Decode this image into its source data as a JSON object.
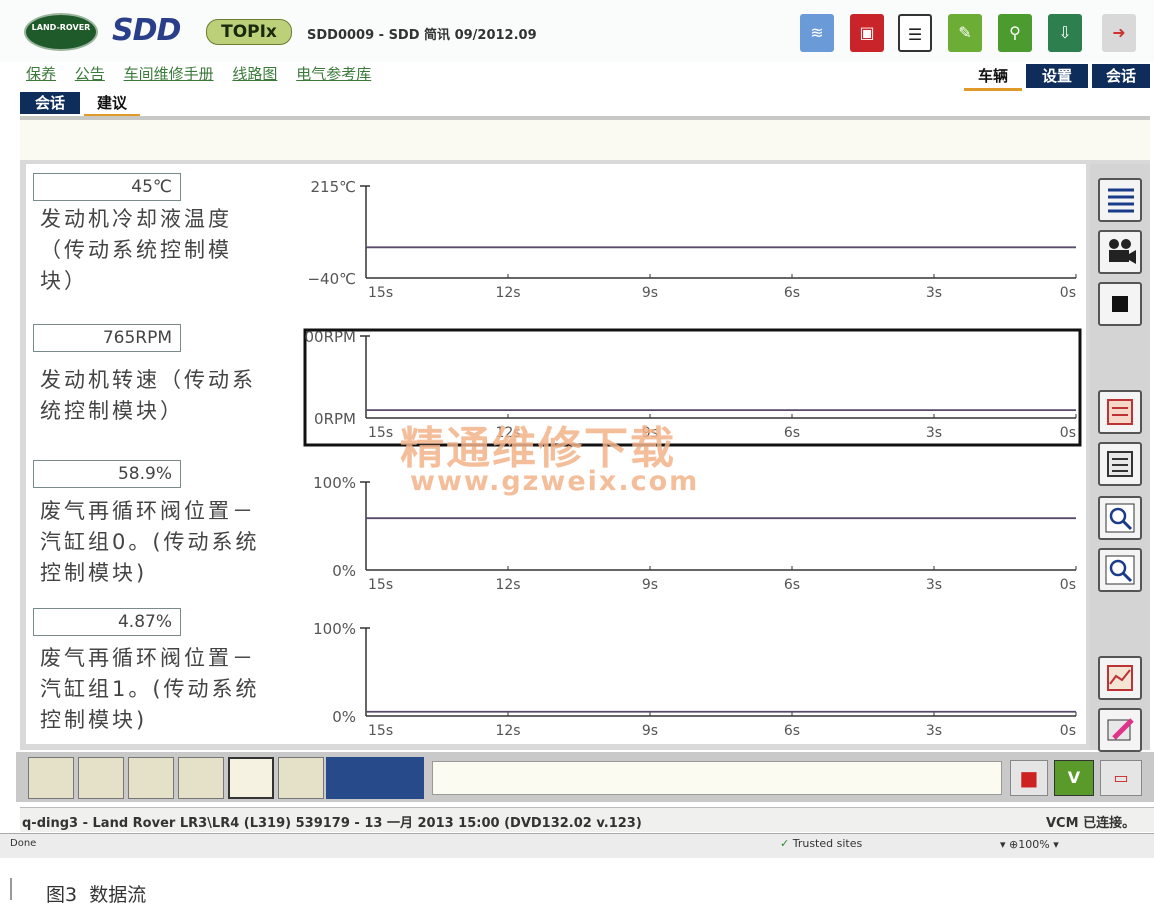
{
  "header": {
    "logo_text": "LAND-ROVER",
    "app_name": "SDD",
    "product": "TOPIx",
    "session_title": "SDD0009 - SDD 简讯 09/2012.09"
  },
  "links": [
    "保养",
    "公告",
    "车间维修手册",
    "线路图",
    "电气参考库"
  ],
  "nav_tabs": [
    {
      "label": "车辆",
      "active": true
    },
    {
      "label": "设置",
      "active": false
    },
    {
      "label": "会话",
      "active": false
    }
  ],
  "sub_tabs": [
    {
      "label": "会话",
      "active": false
    },
    {
      "label": "建议",
      "active": true
    }
  ],
  "signals": [
    {
      "value": "45℃",
      "label": "发动机冷却液温度（传动系统控制模块）"
    },
    {
      "value": "765RPM",
      "label": "发动机转速（传动系统控制模块）"
    },
    {
      "value": "58.9%",
      "label": "废气再循环阀位置－汽缸组0。(传动系统控制模块)"
    },
    {
      "value": "4.87%",
      "label": "废气再循环阀位置－汽缸组1。(传动系统控制模块)"
    }
  ],
  "chart_data": [
    {
      "type": "line",
      "ylabel_top": "215℃",
      "ylabel_bottom": "−40℃",
      "ylim": [
        -40,
        215
      ],
      "x_ticks": [
        "15s",
        "12s",
        "9s",
        "6s",
        "3s",
        "0s"
      ],
      "x": [
        15,
        0
      ],
      "y": [
        45,
        45
      ]
    },
    {
      "type": "line",
      "ylabel_top": "00RPM",
      "ylabel_bottom": "0RPM",
      "ylim": [
        0,
        8000
      ],
      "x_ticks": [
        "15s",
        "12s",
        "9s",
        "6s",
        "3s",
        "0s"
      ],
      "x": [
        15,
        0
      ],
      "y": [
        765,
        765
      ],
      "selected": true
    },
    {
      "type": "line",
      "ylabel_top": "100%",
      "ylabel_bottom": "0%",
      "ylim": [
        0,
        100
      ],
      "x_ticks": [
        "15s",
        "12s",
        "9s",
        "6s",
        "3s",
        "0s"
      ],
      "x": [
        15,
        0
      ],
      "y": [
        58.9,
        58.9
      ]
    },
    {
      "type": "line",
      "ylabel_top": "100%",
      "ylabel_bottom": "0%",
      "ylim": [
        0,
        100
      ],
      "x_ticks": [
        "15s",
        "12s",
        "9s",
        "6s",
        "3s",
        "0s"
      ],
      "x": [
        15,
        0
      ],
      "y": [
        4.87,
        4.87
      ]
    }
  ],
  "watermark": {
    "line1": "精通维修下载",
    "line2": "www.gzweix.com"
  },
  "status": {
    "vehicle": "q-ding3 - Land Rover LR3\\LR4 (L319) 539179 - 13 一月 2013 15:00 (DVD132.02 v.123)",
    "vcm": "VCM 已连接。"
  },
  "ie_status": {
    "left": "Done",
    "zone": "Trusted sites",
    "zoom": "100%"
  },
  "caption": {
    "figure": "图3",
    "title": "数据流"
  },
  "colors": {
    "accent": "#0e2d5a",
    "link": "#3a7a3a",
    "watermark": "#f0a070"
  }
}
